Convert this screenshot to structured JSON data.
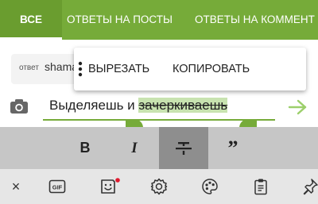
{
  "tabs": [
    {
      "label": "ВСЕ",
      "active": true
    },
    {
      "label": "ОТВЕТЫ НА ПОСТЫ",
      "active": false
    },
    {
      "label": "ОТВЕТЫ НА КОММЕНТ",
      "active": false
    }
  ],
  "reply_preview": {
    "label": "ответ",
    "author": "shama"
  },
  "context_menu": {
    "cut": "ВЫРЕЗАТЬ",
    "copy": "КОПИРОВАТЬ",
    "more_icon": "more-vertical-icon"
  },
  "composer": {
    "text_plain": "Выделяешь и ",
    "text_selected": "зачеркиваешь",
    "camera_icon": "camera-icon",
    "send_icon": "send-icon"
  },
  "format_toolbar": {
    "bold": "B",
    "italic": "I",
    "strike_icon": "strikethrough-icon",
    "quote": "”",
    "active": "strikethrough"
  },
  "keyboard_toolbar": {
    "close": "×",
    "gif": "GIF",
    "icons": [
      "close-icon",
      "gif-icon",
      "sticker-icon",
      "settings-icon",
      "palette-icon",
      "clipboard-icon",
      "pin-icon"
    ]
  },
  "colors": {
    "accent": "#76ab39",
    "selection": "#c8e3b0",
    "toolbar": "#c6c6c6",
    "toolbar_active": "#8e8e8e",
    "notification_dot": "#e0192e"
  }
}
